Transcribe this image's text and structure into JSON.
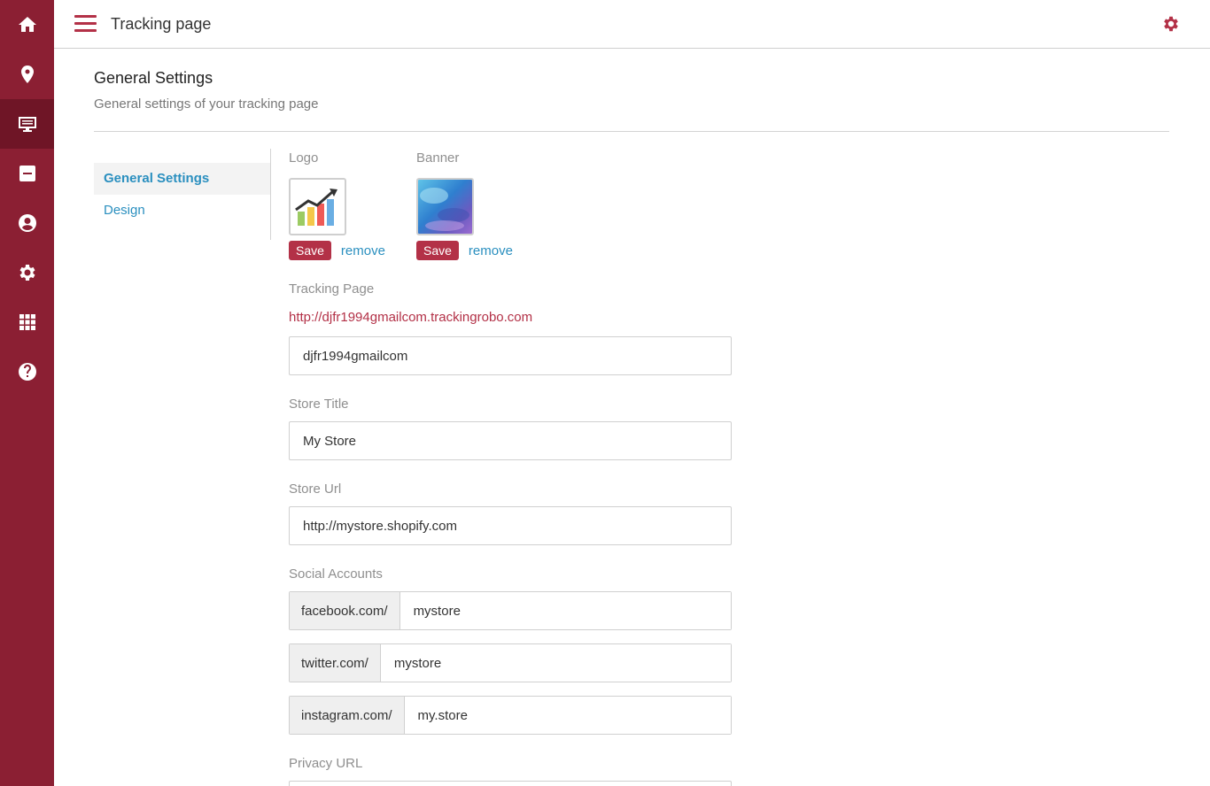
{
  "header": {
    "title": "Tracking page"
  },
  "page": {
    "title": "General Settings",
    "subtitle": "General settings of your tracking page"
  },
  "subnav": {
    "items": [
      {
        "label": "General Settings",
        "active": true
      },
      {
        "label": "Design",
        "active": false
      }
    ]
  },
  "images": {
    "logo": {
      "label": "Logo",
      "save": "Save",
      "remove": "remove"
    },
    "banner": {
      "label": "Banner",
      "save": "Save",
      "remove": "remove"
    }
  },
  "tracking": {
    "label": "Tracking Page",
    "url": "http://djfr1994gmailcom.trackingrobo.com",
    "value": "djfr1994gmailcom"
  },
  "store_title": {
    "label": "Store Title",
    "value": "My Store"
  },
  "store_url": {
    "label": "Store Url",
    "value": "http://mystore.shopify.com"
  },
  "social": {
    "label": "Social Accounts",
    "accounts": [
      {
        "prefix": "facebook.com/",
        "value": "mystore"
      },
      {
        "prefix": "twitter.com/",
        "value": "mystore"
      },
      {
        "prefix": "instagram.com/",
        "value": "my.store"
      }
    ]
  },
  "privacy": {
    "label": "Privacy URL"
  },
  "sidebar_icons": [
    "home-icon",
    "location-pin-icon",
    "monitor-icon",
    "minus-box-icon",
    "user-icon",
    "gear-icon",
    "grid-icon",
    "help-icon"
  ],
  "colors": {
    "sidebar": "#8b1f33",
    "accent": "#b33147",
    "link": "#2a8fbf"
  }
}
